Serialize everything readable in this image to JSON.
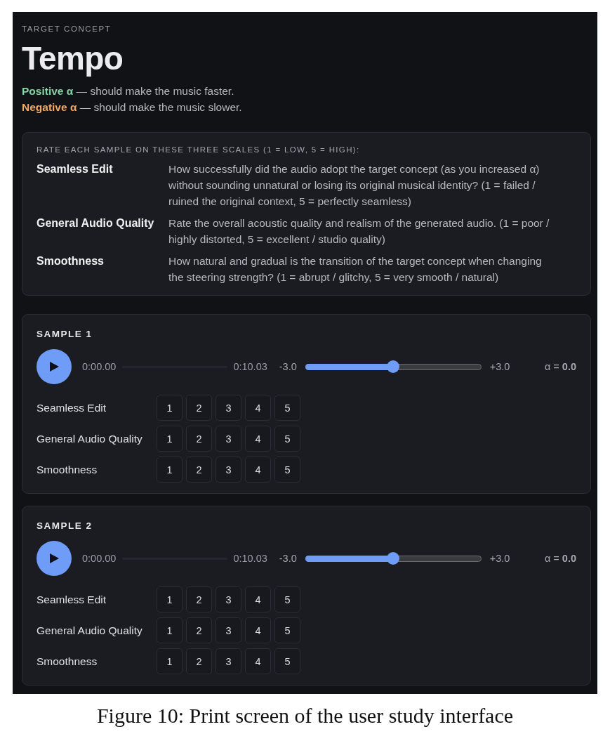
{
  "header": {
    "eyebrow": "TARGET CONCEPT",
    "title": "Tempo",
    "hints": [
      {
        "term": "Positive α",
        "text": "— should make the music faster.",
        "color": "#86d3a3"
      },
      {
        "term": "Negative α",
        "text": "— should make the music slower.",
        "color": "#f2a862"
      }
    ]
  },
  "criteria": {
    "heading": "RATE EACH SAMPLE ON THESE THREE SCALES (1 = LOW, 5 = HIGH):",
    "items": [
      {
        "name": "Seamless Edit",
        "description": "How successfully did the audio adopt the target concept (as you increased α) without sounding unnatural or losing its original musical identity? (1 = failed / ruined the original context, 5 = perfectly seamless)"
      },
      {
        "name": "General Audio Quality",
        "description": "Rate the overall acoustic quality and realism of the generated audio. (1 = poor / highly distorted, 5 = excellent / studio quality)"
      },
      {
        "name": "Smoothness",
        "description": "How natural and gradual is the transition of the target concept when changing the steering strength? (1 = abrupt / glitchy, 5 = very smooth / natural)"
      }
    ]
  },
  "samples": [
    {
      "title": "SAMPLE 1",
      "player": {
        "current_time": "0:00.00",
        "duration": "0:10.03"
      },
      "steering": {
        "min_label": "-3.0",
        "max_label": "+3.0",
        "level": 0.5,
        "readout": "α = **0.0**"
      },
      "ratings": [
        {
          "label": "Seamless Edit",
          "options": [
            {
              "label": "1",
              "selected": false
            },
            {
              "label": "2",
              "selected": false
            },
            {
              "label": "3",
              "selected": false
            },
            {
              "label": "4",
              "selected": false
            },
            {
              "label": "5",
              "selected": false
            }
          ]
        },
        {
          "label": "General Audio Quality",
          "options": [
            {
              "label": "1",
              "selected": false
            },
            {
              "label": "2",
              "selected": false
            },
            {
              "label": "3",
              "selected": false
            },
            {
              "label": "4",
              "selected": false
            },
            {
              "label": "5",
              "selected": false
            }
          ]
        },
        {
          "label": "Smoothness",
          "options": [
            {
              "label": "1",
              "selected": false
            },
            {
              "label": "2",
              "selected": false
            },
            {
              "label": "3",
              "selected": false
            },
            {
              "label": "4",
              "selected": false
            },
            {
              "label": "5",
              "selected": false
            }
          ]
        }
      ]
    },
    {
      "title": "SAMPLE 2",
      "player": {
        "current_time": "0:00.00",
        "duration": "0:10.03"
      },
      "steering": {
        "min_label": "-3.0",
        "max_label": "+3.0",
        "level": 0.5,
        "readout": "α = **0.0**"
      },
      "ratings": [
        {
          "label": "Seamless Edit",
          "options": [
            {
              "label": "1",
              "selected": false
            },
            {
              "label": "2",
              "selected": false
            },
            {
              "label": "3",
              "selected": false
            },
            {
              "label": "4",
              "selected": false
            },
            {
              "label": "5",
              "selected": false
            }
          ]
        },
        {
          "label": "General Audio Quality",
          "options": [
            {
              "label": "1",
              "selected": false
            },
            {
              "label": "2",
              "selected": false
            },
            {
              "label": "3",
              "selected": false
            },
            {
              "label": "4",
              "selected": false
            },
            {
              "label": "5",
              "selected": false
            }
          ]
        },
        {
          "label": "Smoothness",
          "options": [
            {
              "label": "1",
              "selected": false
            },
            {
              "label": "2",
              "selected": false
            },
            {
              "label": "3",
              "selected": false
            },
            {
              "label": "4",
              "selected": false
            },
            {
              "label": "5",
              "selected": false
            }
          ]
        }
      ]
    }
  ],
  "caption": "Figure 10: Print screen of the user study interface"
}
